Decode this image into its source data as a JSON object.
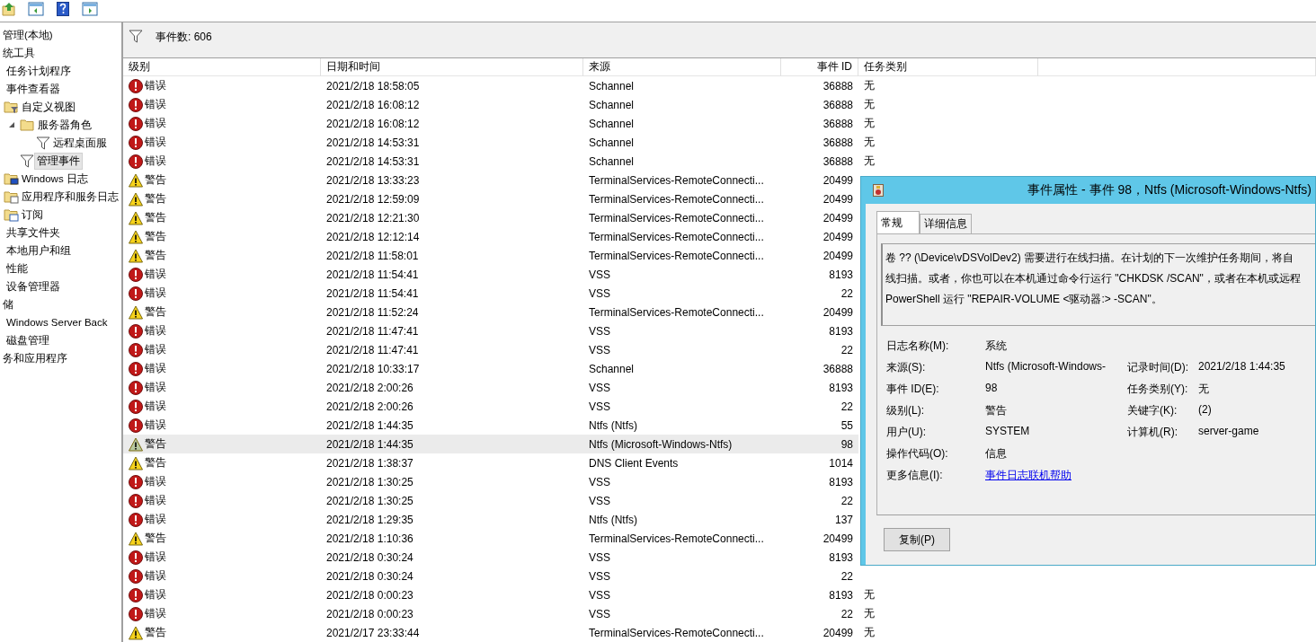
{
  "toolbar": {
    "buttons": [
      {
        "kind": "up"
      },
      {
        "kind": "pane-left"
      },
      {
        "kind": "help"
      },
      {
        "kind": "pane-right"
      }
    ]
  },
  "tree": [
    {
      "label": "管理(本地)",
      "selected": false,
      "children": [
        {
          "label": "统工具",
          "selected": false,
          "children": [
            {
              "label": "任务计划程序",
              "selected": false
            },
            {
              "label": "事件查看器",
              "selected": false,
              "children": [
                {
                  "label": "自定义视图",
                  "selected": false,
                  "kind": "folder-filter",
                  "children": [
                    {
                      "label": "服务器角色",
                      "selected": false,
                      "kind": "folder",
                      "expanded": true,
                      "children": [
                        {
                          "label": "远程桌面服",
                          "selected": false,
                          "kind": "filter"
                        }
                      ]
                    },
                    {
                      "label": "管理事件",
                      "selected": true,
                      "kind": "filter"
                    }
                  ]
                },
                {
                  "label": "Windows 日志",
                  "selected": false,
                  "kind": "folder-log"
                },
                {
                  "label": "应用程序和服务日志",
                  "selected": false,
                  "kind": "folder-doc"
                },
                {
                  "label": "订阅",
                  "selected": false,
                  "kind": "folder-sub"
                }
              ]
            },
            {
              "label": "共享文件夹",
              "selected": false
            },
            {
              "label": "本地用户和组",
              "selected": false
            },
            {
              "label": "性能",
              "selected": false
            },
            {
              "label": "设备管理器",
              "selected": false
            }
          ]
        },
        {
          "label": "储",
          "selected": false,
          "children": [
            {
              "label": "Windows Server Back",
              "selected": false
            },
            {
              "label": "磁盘管理",
              "selected": false
            }
          ]
        },
        {
          "label": "务和应用程序",
          "selected": false
        }
      ]
    }
  ],
  "event_count": "事件数: 606",
  "table": {
    "columns": [
      "级别",
      "日期和时间",
      "来源",
      "事件 ID",
      "任务类别"
    ],
    "rows": [
      {
        "kind": "error",
        "level": "错误",
        "time": "2021/2/18 18:58:05",
        "source": "Schannel",
        "id": "36888",
        "task": "无",
        "selected": false
      },
      {
        "kind": "error",
        "level": "错误",
        "time": "2021/2/18 16:08:12",
        "source": "Schannel",
        "id": "36888",
        "task": "无",
        "selected": false
      },
      {
        "kind": "error",
        "level": "错误",
        "time": "2021/2/18 16:08:12",
        "source": "Schannel",
        "id": "36888",
        "task": "无",
        "selected": false
      },
      {
        "kind": "error",
        "level": "错误",
        "time": "2021/2/18 14:53:31",
        "source": "Schannel",
        "id": "36888",
        "task": "无",
        "selected": false
      },
      {
        "kind": "error",
        "level": "错误",
        "time": "2021/2/18 14:53:31",
        "source": "Schannel",
        "id": "36888",
        "task": "无",
        "selected": false
      },
      {
        "kind": "warning",
        "level": "警告",
        "time": "2021/2/18 13:33:23",
        "source": "TerminalServices-RemoteConnecti...",
        "id": "20499",
        "selected": false
      },
      {
        "kind": "warning",
        "level": "警告",
        "time": "2021/2/18 12:59:09",
        "source": "TerminalServices-RemoteConnecti...",
        "id": "20499",
        "selected": false
      },
      {
        "kind": "warning",
        "level": "警告",
        "time": "2021/2/18 12:21:30",
        "source": "TerminalServices-RemoteConnecti...",
        "id": "20499",
        "selected": false
      },
      {
        "kind": "warning",
        "level": "警告",
        "time": "2021/2/18 12:12:14",
        "source": "TerminalServices-RemoteConnecti...",
        "id": "20499",
        "selected": false
      },
      {
        "kind": "warning",
        "level": "警告",
        "time": "2021/2/18 11:58:01",
        "source": "TerminalServices-RemoteConnecti...",
        "id": "20499",
        "selected": false
      },
      {
        "kind": "error",
        "level": "错误",
        "time": "2021/2/18 11:54:41",
        "source": "VSS",
        "id": "8193",
        "selected": false
      },
      {
        "kind": "error",
        "level": "错误",
        "time": "2021/2/18 11:54:41",
        "source": "VSS",
        "id": "22",
        "selected": false
      },
      {
        "kind": "warning",
        "level": "警告",
        "time": "2021/2/18 11:52:24",
        "source": "TerminalServices-RemoteConnecti...",
        "id": "20499",
        "selected": false
      },
      {
        "kind": "error",
        "level": "错误",
        "time": "2021/2/18 11:47:41",
        "source": "VSS",
        "id": "8193",
        "selected": false
      },
      {
        "kind": "error",
        "level": "错误",
        "time": "2021/2/18 11:47:41",
        "source": "VSS",
        "id": "22",
        "selected": false
      },
      {
        "kind": "error",
        "level": "错误",
        "time": "2021/2/18 10:33:17",
        "source": "Schannel",
        "id": "36888",
        "selected": false
      },
      {
        "kind": "error",
        "level": "错误",
        "time": "2021/2/18 2:00:26",
        "source": "VSS",
        "id": "8193",
        "selected": false
      },
      {
        "kind": "error",
        "level": "错误",
        "time": "2021/2/18 2:00:26",
        "source": "VSS",
        "id": "22",
        "selected": false
      },
      {
        "kind": "error",
        "level": "错误",
        "time": "2021/2/18 1:44:35",
        "source": "Ntfs (Ntfs)",
        "id": "55",
        "selected": false
      },
      {
        "kind": "warning",
        "level": "警告",
        "time": "2021/2/18 1:44:35",
        "source": "Ntfs (Microsoft-Windows-Ntfs)",
        "id": "98",
        "selected": true
      },
      {
        "kind": "warning",
        "level": "警告",
        "time": "2021/2/18 1:38:37",
        "source": "DNS Client Events",
        "id": "1014",
        "selected": false
      },
      {
        "kind": "error",
        "level": "错误",
        "time": "2021/2/18 1:30:25",
        "source": "VSS",
        "id": "8193",
        "selected": false
      },
      {
        "kind": "error",
        "level": "错误",
        "time": "2021/2/18 1:30:25",
        "source": "VSS",
        "id": "22",
        "selected": false
      },
      {
        "kind": "error",
        "level": "错误",
        "time": "2021/2/18 1:29:35",
        "source": "Ntfs (Ntfs)",
        "id": "137",
        "selected": false
      },
      {
        "kind": "warning",
        "level": "警告",
        "time": "2021/2/18 1:10:36",
        "source": "TerminalServices-RemoteConnecti...",
        "id": "20499",
        "selected": false
      },
      {
        "kind": "error",
        "level": "错误",
        "time": "2021/2/18 0:30:24",
        "source": "VSS",
        "id": "8193",
        "selected": false
      },
      {
        "kind": "error",
        "level": "错误",
        "time": "2021/2/18 0:30:24",
        "source": "VSS",
        "id": "22",
        "selected": false
      },
      {
        "kind": "error",
        "level": "错误",
        "time": "2021/2/18 0:00:23",
        "source": "VSS",
        "id": "8193",
        "task": "无",
        "selected": false
      },
      {
        "kind": "error",
        "level": "错误",
        "time": "2021/2/18 0:00:23",
        "source": "VSS",
        "id": "22",
        "task": "无",
        "selected": false
      },
      {
        "kind": "warning",
        "level": "警告",
        "time": "2021/2/17 23:33:44",
        "source": "TerminalServices-RemoteConnecti...",
        "id": "20499",
        "task": "无",
        "selected": false
      }
    ]
  },
  "dialog": {
    "title": "事件属性 - 事件 98，Ntfs (Microsoft-Windows-Ntfs)",
    "tabs": [
      {
        "label": "常规",
        "selected": true
      },
      {
        "label": "详细信息",
        "selected": false
      }
    ],
    "description": [
      "卷 ?? (\\Device\\vDSVolDev2) 需要进行在线扫描。在计划的下一次维护任务期间，将自",
      "线扫描。或者，你也可以在本机通过命令行运行 \"CHKDSK /SCAN\"，或者在本机或远程",
      "PowerShell 运行 \"REPAIR-VOLUME <驱动器:> -SCAN\"。"
    ],
    "fields": [
      {
        "label": "日志名称(M):",
        "value": "系统"
      },
      {
        "label": "来源(S):",
        "value": "Ntfs (Microsoft-Windows-",
        "label2": "记录时间(D):",
        "value2": "2021/2/18 1:44:35"
      },
      {
        "label": "事件 ID(E):",
        "value": "98",
        "label2": "任务类别(Y):",
        "value2": "无"
      },
      {
        "label": "级别(L):",
        "value": "警告",
        "label2": "关键字(K):",
        "value2": "(2)"
      },
      {
        "label": "用户(U):",
        "value": "SYSTEM",
        "label2": "计算机(R):",
        "value2": "server-game"
      },
      {
        "label": "操作代码(O):",
        "value": "信息"
      },
      {
        "label": "更多信息(I):",
        "link": "事件日志联机帮助"
      }
    ],
    "copy_button": "复制(P)"
  }
}
